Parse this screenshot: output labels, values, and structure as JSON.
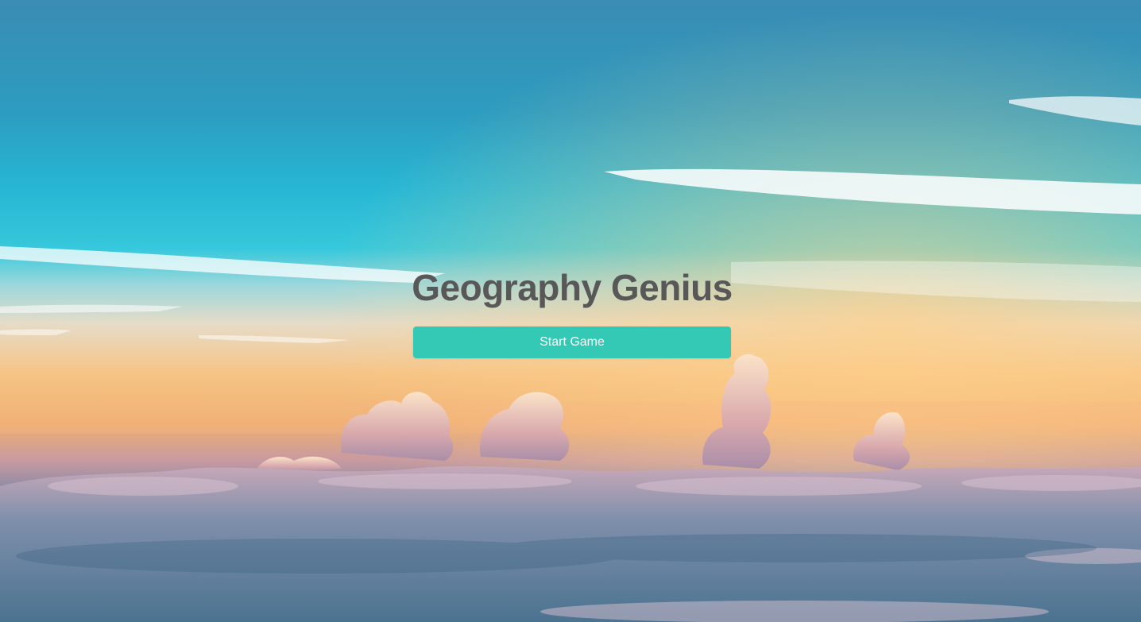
{
  "app": {
    "title": "Geography Genius"
  },
  "actions": {
    "start_label": "Start Game"
  },
  "theme": {
    "button_color": "#33c9b5",
    "title_color": "#585858",
    "background": "sky-above-clouds-sunset-photo"
  }
}
